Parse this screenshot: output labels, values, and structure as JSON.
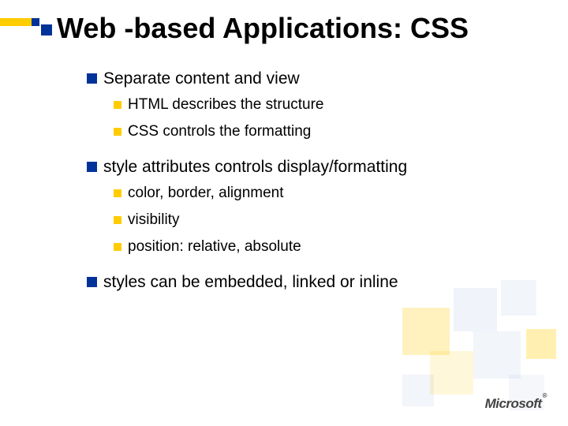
{
  "title": "Web -based Applications: CSS",
  "group1": {
    "heading": "Separate content and view",
    "items": [
      "HTML describes the structure",
      "CSS controls the formatting"
    ]
  },
  "group2": {
    "heading": "style attributes controls display/formatting",
    "items": [
      "color, border, alignment",
      "visibility",
      "position: relative, absolute"
    ]
  },
  "group3": {
    "heading": "styles can be embedded, linked or inline"
  },
  "logo": "Microsoft"
}
